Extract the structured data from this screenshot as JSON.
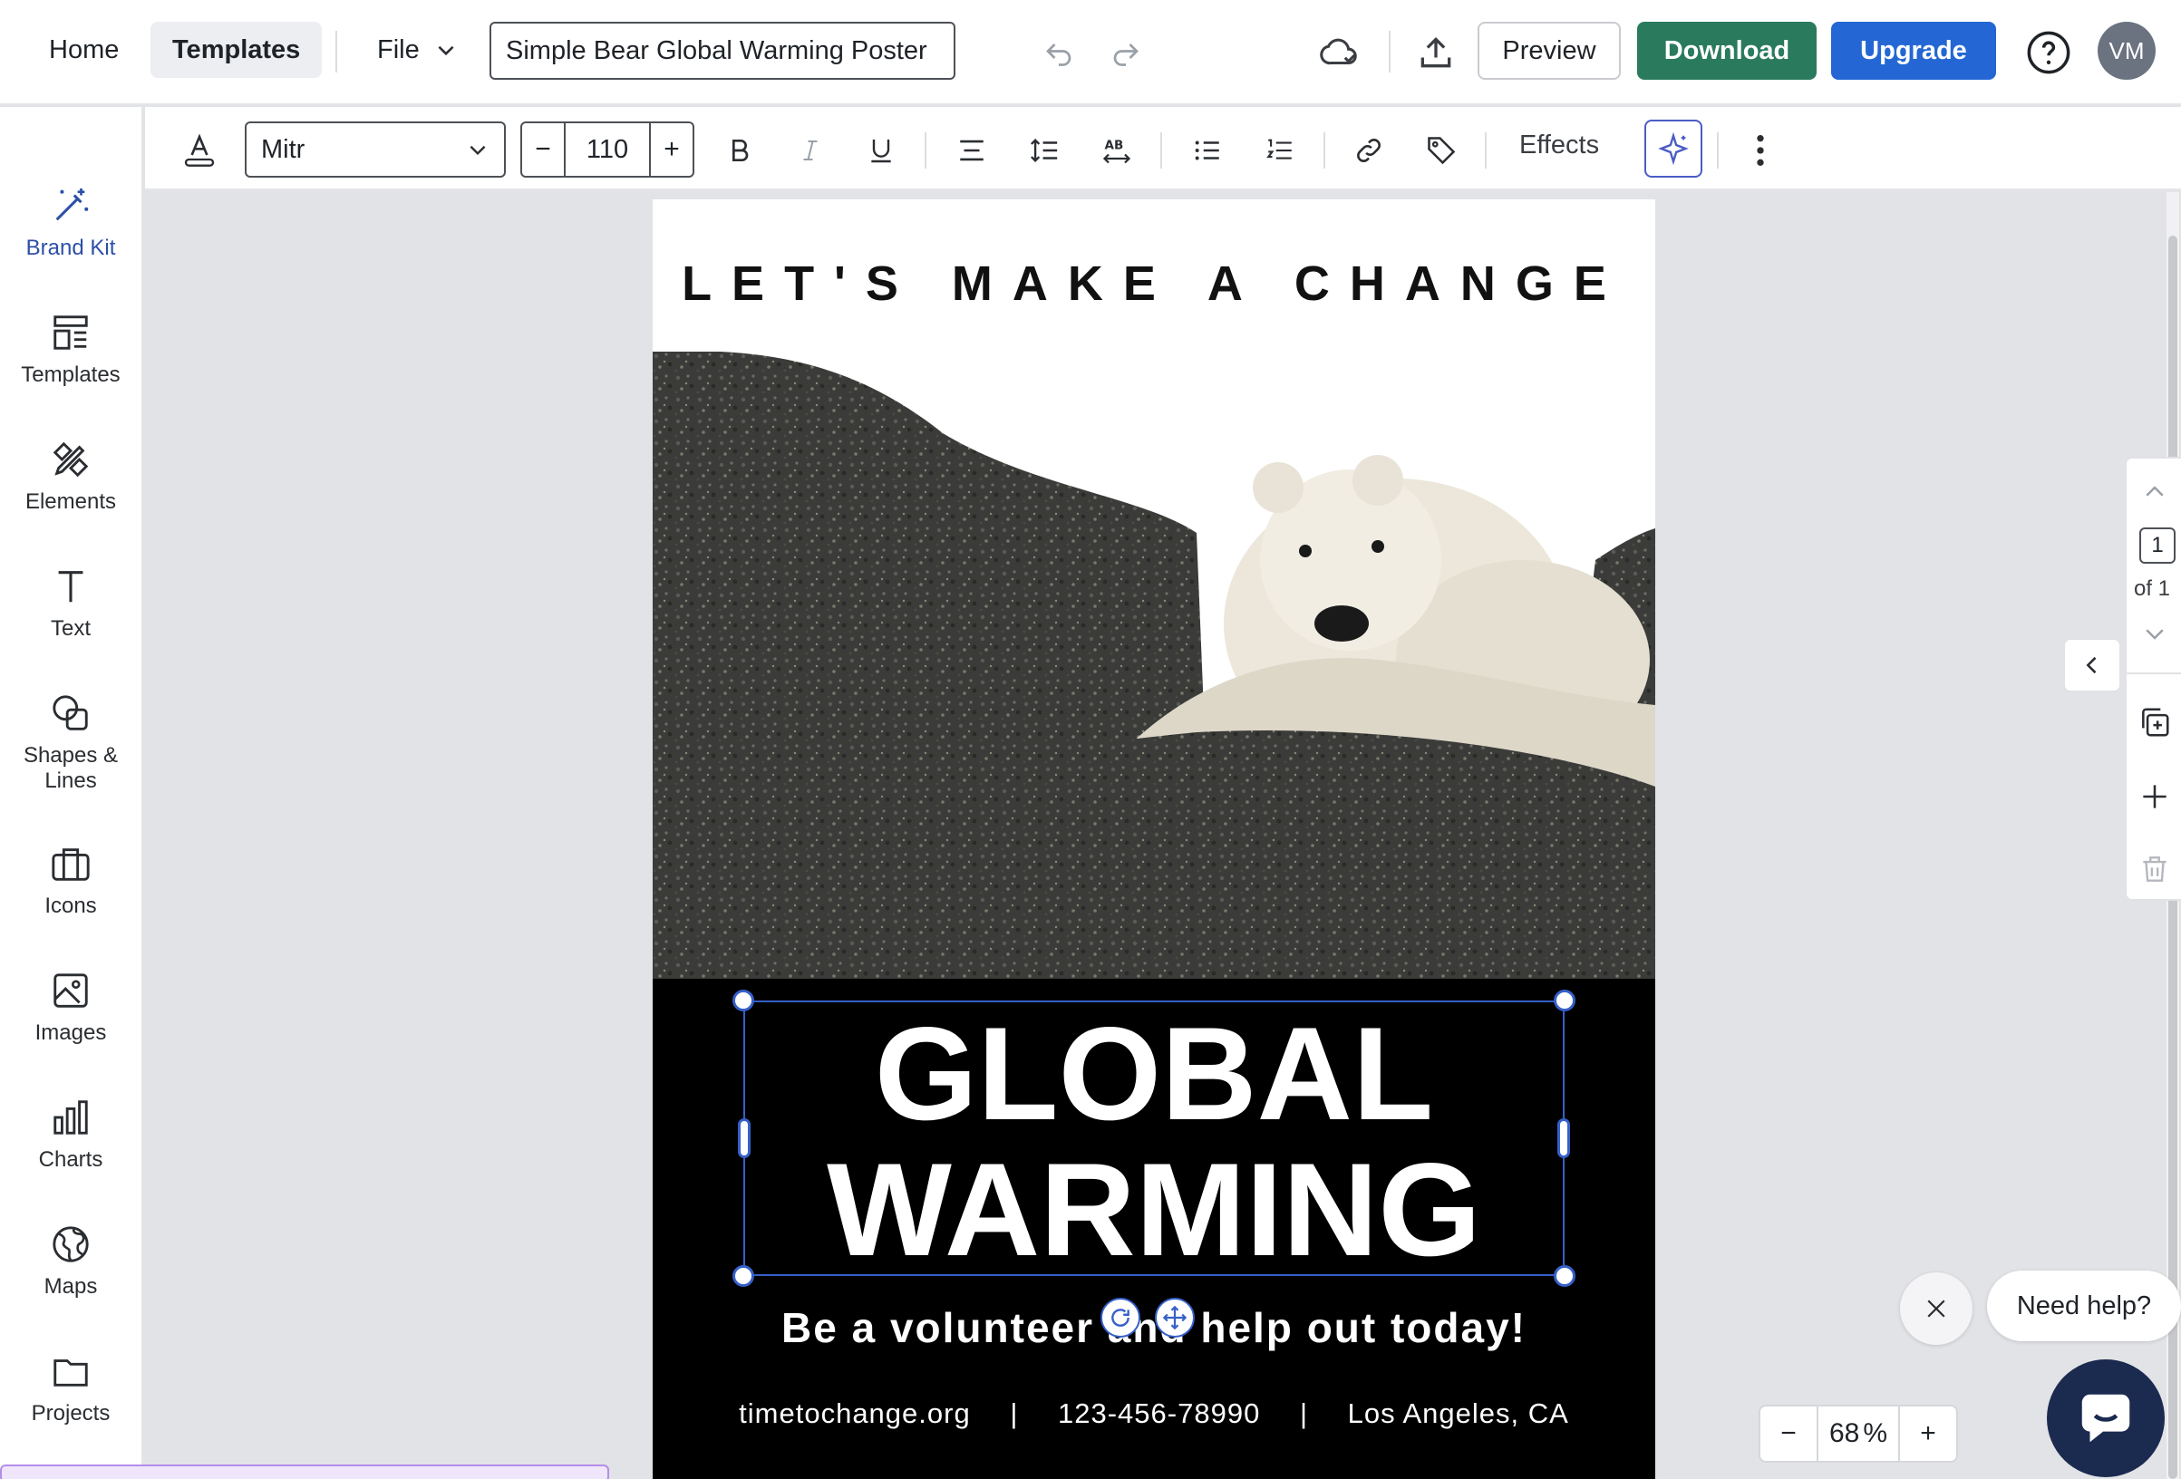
{
  "topbar": {
    "home": "Home",
    "templates": "Templates",
    "file": "File",
    "doc_title": "Simple Bear Global Warming Poster",
    "preview": "Preview",
    "download": "Download",
    "upgrade": "Upgrade",
    "avatar": "VM"
  },
  "sidebar": {
    "items": [
      {
        "label": "Brand Kit"
      },
      {
        "label": "Templates"
      },
      {
        "label": "Elements"
      },
      {
        "label": "Text"
      },
      {
        "label": "Shapes & Lines"
      },
      {
        "label": "Icons"
      },
      {
        "label": "Images"
      },
      {
        "label": "Charts"
      },
      {
        "label": "Maps"
      },
      {
        "label": "Projects"
      }
    ]
  },
  "toolbar": {
    "font": "Mitr",
    "size": "110",
    "effects": "Effects"
  },
  "poster": {
    "headline": "LET'S MAKE A CHANGE",
    "title_line1": "GLOBAL",
    "title_line2": "WARMING",
    "subtitle": "Be a volunteer and help out today!",
    "website": "timetochange.org",
    "phone": "123-456-78990",
    "location": "Los Angeles, CA",
    "separator": "|"
  },
  "pages": {
    "current": "1",
    "of": "of 1"
  },
  "help": {
    "label": "Need help?"
  },
  "zoom": {
    "value": "68",
    "unit": "%"
  },
  "colors": {
    "accent_blue": "#2467d4",
    "download_green": "#2a7a5e",
    "selection": "#3660c9"
  }
}
